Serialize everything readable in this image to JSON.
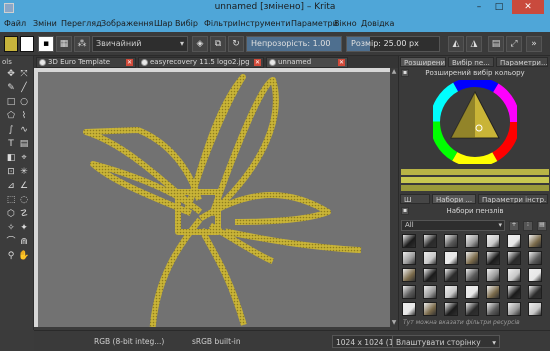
{
  "window": {
    "title": "unnamed [змінено] – Krita",
    "minimize": "–",
    "maximize": "□",
    "close": "✕"
  },
  "menu": [
    "Файл",
    "Зміни",
    "Перегляд",
    "Зображення",
    "Шар",
    "Вибір",
    "Фільтри",
    "Інструменти",
    "Параметри",
    "Вікно",
    "Довідка"
  ],
  "toolbar": {
    "blend_mode": "Звичайний",
    "opacity_label": "Непрозорість:",
    "opacity_value": "1.00",
    "opacity_fraction": 1.0,
    "size_label": "Розмір:",
    "size_value": "25.00 px",
    "size_fraction": 0.25,
    "fg_color": "#c8b43c",
    "bg_color": "#ffffff"
  },
  "toolbox": {
    "title": "ols",
    "tools": [
      "move-icon",
      "transform-icon",
      "brush-icon",
      "line-icon",
      "rectangle-icon",
      "ellipse-icon",
      "polygon-icon",
      "polyline-icon",
      "bezier-icon",
      "freehand-path-icon",
      "text-icon",
      "gradient-icon",
      "fill-icon",
      "colorpicker-icon",
      "crop-icon",
      "multibrush-icon",
      "assistant-icon",
      "measure-icon",
      "rect-select-icon",
      "ellipse-select-icon",
      "polygon-select-icon",
      "freehand-select-icon",
      "contiguous-select-icon",
      "similar-select-icon",
      "bezier-select-icon",
      "magnetic-select-icon",
      "zoom-icon",
      "pan-icon"
    ]
  },
  "tabs": [
    {
      "label": "3D Euro Template",
      "active": false
    },
    {
      "label": "easyrecovery 11.5 logo2.jpg",
      "active": false
    },
    {
      "label": "unnamed",
      "active": true
    }
  ],
  "status": {
    "color_model": "RGB (8-bit integ...)",
    "profile": "sRGB built-in",
    "dimensions": "1024 x 1024 (13M)",
    "fit_page": "Влаштувати сторінку"
  },
  "dock": {
    "top_tabs": [
      "Розширений",
      "Вибір пе...",
      "Параметри..."
    ],
    "color_panel_title": "Розширений вибір кольору",
    "bottom_tabs": [
      "Ш",
      "Набори ...",
      "Параметри інстр..."
    ],
    "presets_title": "Набори пензлів",
    "filter_value": "All",
    "tag_hint": "Тут можна вказати фільтри ресурсів",
    "strip_colors": [
      "#c8c850",
      "#a0a030",
      "#b8b040",
      "#8a9420",
      "#7a7a20"
    ]
  },
  "colors": {
    "accent": "#4fa6d8",
    "stroke": "#c9b437",
    "canvas": "#727272"
  }
}
